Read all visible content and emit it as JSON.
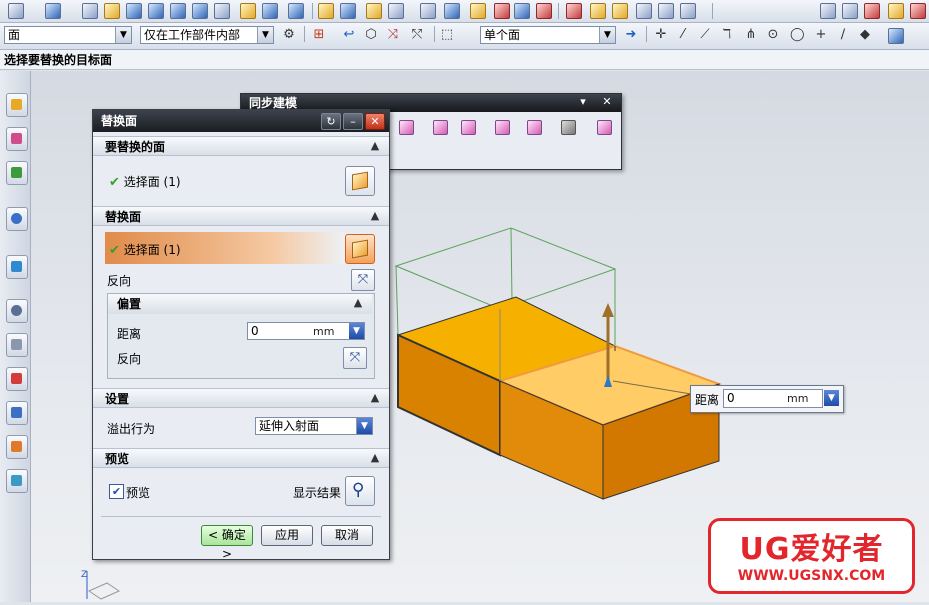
{
  "toolbar2": {
    "filter_value": "面",
    "scope_value": "仅在工作部件内部",
    "face_rule_value": "单个面"
  },
  "cue_line": "选择要替换的目标面",
  "sync_toolbar": {
    "title": "同步建模"
  },
  "dialog": {
    "title": "替换面",
    "group_target": "要替换的面",
    "select_face_target": "选择面 (1)",
    "group_replace": "替换面",
    "select_face_replace": "选择面 (1)",
    "reverse_label": "反向",
    "group_offset": "偏置",
    "distance_label": "距离",
    "distance_value": "0",
    "distance_unit": "mm",
    "offset_reverse_label": "反向",
    "group_settings": "设置",
    "overflow_label": "溢出行为",
    "overflow_value": "延伸入射面",
    "group_preview": "预览",
    "preview_label": "预览",
    "show_result_label": "显示结果",
    "ok_label": "< 确定 >",
    "apply_label": "应用",
    "cancel_label": "取消"
  },
  "floating_input": {
    "label": "距离",
    "value": "0",
    "unit": "mm"
  },
  "watermark": {
    "brand": "UG爱好者",
    "url": "WWW.UGSNX.COM"
  },
  "colors": {
    "model_face": "#f5b000",
    "model_side": "#d97e00",
    "selected_face": "#ffcc66",
    "wireframe": "#5aa25a"
  }
}
